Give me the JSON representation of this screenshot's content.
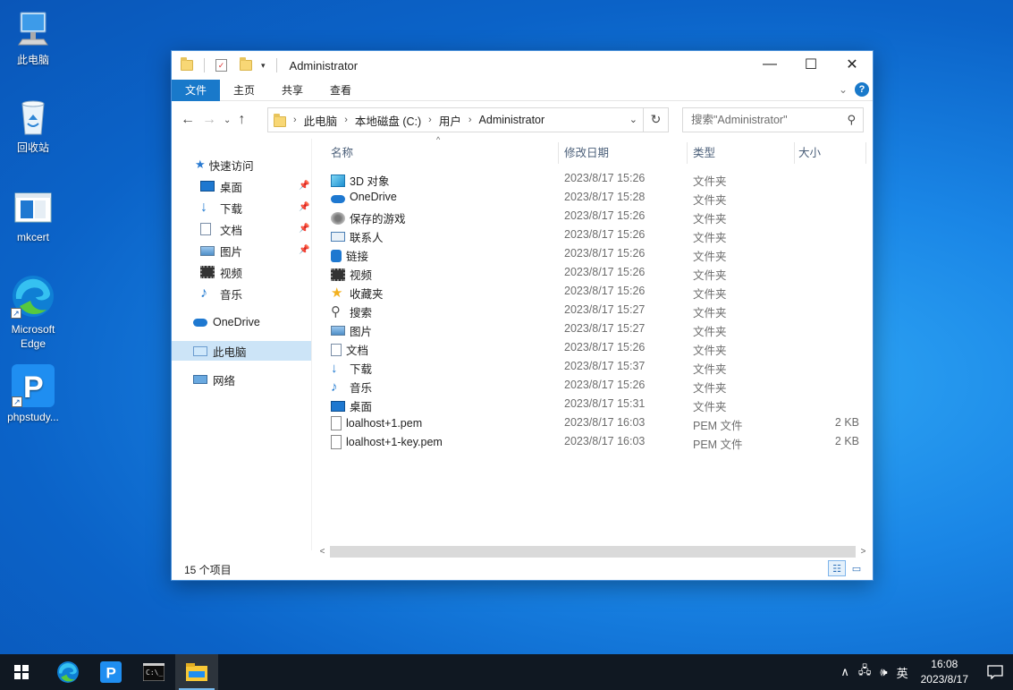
{
  "desktop": {
    "icons": [
      {
        "label": "此电脑"
      },
      {
        "label": "回收站"
      },
      {
        "label": "mkcert"
      },
      {
        "label": "Microsoft Edge"
      },
      {
        "label": "phpstudy..."
      }
    ]
  },
  "window": {
    "title": "Administrator",
    "controls": {
      "minimize": "—",
      "maximize": "☐",
      "close": "✕"
    },
    "ribbon_tabs": [
      "文件",
      "主页",
      "共享",
      "查看"
    ],
    "help": "?",
    "address": {
      "crumbs": [
        "此电脑",
        "本地磁盘 (C:)",
        "用户",
        "Administrator"
      ]
    },
    "search": {
      "placeholder": "搜索\"Administrator\""
    },
    "nav": {
      "quick_access": "快速访问",
      "pinned": [
        "桌面",
        "下载",
        "文档",
        "图片"
      ],
      "others": [
        "视频",
        "音乐"
      ],
      "onedrive": "OneDrive",
      "this_pc": "此电脑",
      "network": "网络"
    },
    "columns": {
      "name": "名称",
      "date": "修改日期",
      "type": "类型",
      "size": "大小"
    },
    "files": [
      {
        "name": "3D 对象",
        "date": "2023/8/17 15:26",
        "type": "文件夹",
        "size": "",
        "icon": "3d-objects-icon"
      },
      {
        "name": "OneDrive",
        "date": "2023/8/17 15:28",
        "type": "文件夹",
        "size": "",
        "icon": "cloud-icon"
      },
      {
        "name": "保存的游戏",
        "date": "2023/8/17 15:26",
        "type": "文件夹",
        "size": "",
        "icon": "saved-games-icon"
      },
      {
        "name": "联系人",
        "date": "2023/8/17 15:26",
        "type": "文件夹",
        "size": "",
        "icon": "contacts-icon"
      },
      {
        "name": "链接",
        "date": "2023/8/17 15:26",
        "type": "文件夹",
        "size": "",
        "icon": "links-icon"
      },
      {
        "name": "视频",
        "date": "2023/8/17 15:26",
        "type": "文件夹",
        "size": "",
        "icon": "video-icon"
      },
      {
        "name": "收藏夹",
        "date": "2023/8/17 15:26",
        "type": "文件夹",
        "size": "",
        "icon": "favorites-star-icon"
      },
      {
        "name": "搜索",
        "date": "2023/8/17 15:27",
        "type": "文件夹",
        "size": "",
        "icon": "search-icon"
      },
      {
        "name": "图片",
        "date": "2023/8/17 15:27",
        "type": "文件夹",
        "size": "",
        "icon": "pictures-icon"
      },
      {
        "name": "文档",
        "date": "2023/8/17 15:26",
        "type": "文件夹",
        "size": "",
        "icon": "documents-icon"
      },
      {
        "name": "下载",
        "date": "2023/8/17 15:37",
        "type": "文件夹",
        "size": "",
        "icon": "download-arrow-icon"
      },
      {
        "name": "音乐",
        "date": "2023/8/17 15:26",
        "type": "文件夹",
        "size": "",
        "icon": "music-note-icon"
      },
      {
        "name": "桌面",
        "date": "2023/8/17 15:31",
        "type": "文件夹",
        "size": "",
        "icon": "desktop-icon"
      },
      {
        "name": "loalhost+1.pem",
        "date": "2023/8/17 16:03",
        "type": "PEM 文件",
        "size": "2 KB",
        "icon": "file-icon"
      },
      {
        "name": "loalhost+1-key.pem",
        "date": "2023/8/17 16:03",
        "type": "PEM 文件",
        "size": "2 KB",
        "icon": "file-icon"
      }
    ],
    "status": {
      "count": "15 个项目"
    }
  },
  "taskbar": {
    "ime": "英",
    "time": "16:08",
    "date": "2023/8/17"
  },
  "colors": {
    "accent": "#1979ca",
    "selection": "#cce4f7",
    "taskbar": "#101822"
  }
}
